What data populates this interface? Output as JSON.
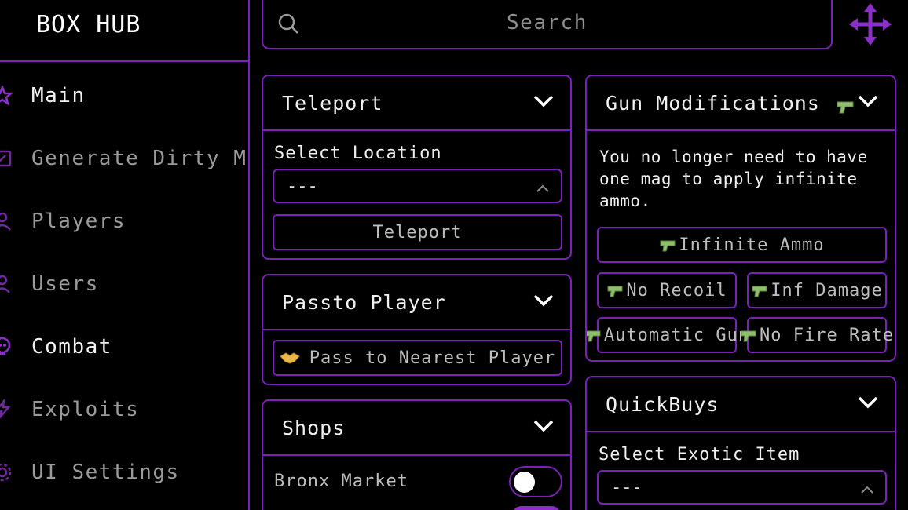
{
  "app": {
    "title": "BOX HUB"
  },
  "colors": {
    "accent": "#7a22b8",
    "background": "#000000",
    "gun": "#8fbf6b"
  },
  "search": {
    "placeholder": "Search"
  },
  "sidebar": {
    "items": [
      {
        "label": "Main",
        "icon": "star-icon",
        "state": "active"
      },
      {
        "label": "Generate Dirty Mon",
        "icon": "money-icon",
        "state": "dim"
      },
      {
        "label": "Players",
        "icon": "players-icon",
        "state": "dim"
      },
      {
        "label": "Users",
        "icon": "user-icon",
        "state": "dim"
      },
      {
        "label": "Combat",
        "icon": "skull-icon",
        "state": "active"
      },
      {
        "label": "Exploits",
        "icon": "bolt-icon",
        "state": "dim"
      },
      {
        "label": "UI Settings",
        "icon": "gear-icon",
        "state": "dim"
      }
    ]
  },
  "teleport": {
    "title": "Teleport",
    "select_label": "Select Location",
    "select_value": "---",
    "button": "Teleport"
  },
  "passto": {
    "title": "Passto Player",
    "button": "Pass to Nearest Player"
  },
  "shops": {
    "title": "Shops",
    "items": [
      {
        "label": "Bronx Market",
        "on": false
      }
    ]
  },
  "gunmods": {
    "title": "Gun Modifications",
    "description": "You no longer need to have one mag to apply infinite ammo.",
    "buttons": {
      "infinite_ammo": "Infinite Ammo",
      "no_recoil": "No Recoil",
      "inf_damage": "Inf Damage",
      "automatic_gun": "Automatic Gun",
      "no_fire_rate": "No Fire Rate"
    }
  },
  "quickbuys": {
    "title": "QuickBuys",
    "select_label": "Select Exotic Item",
    "select_value": "---"
  }
}
